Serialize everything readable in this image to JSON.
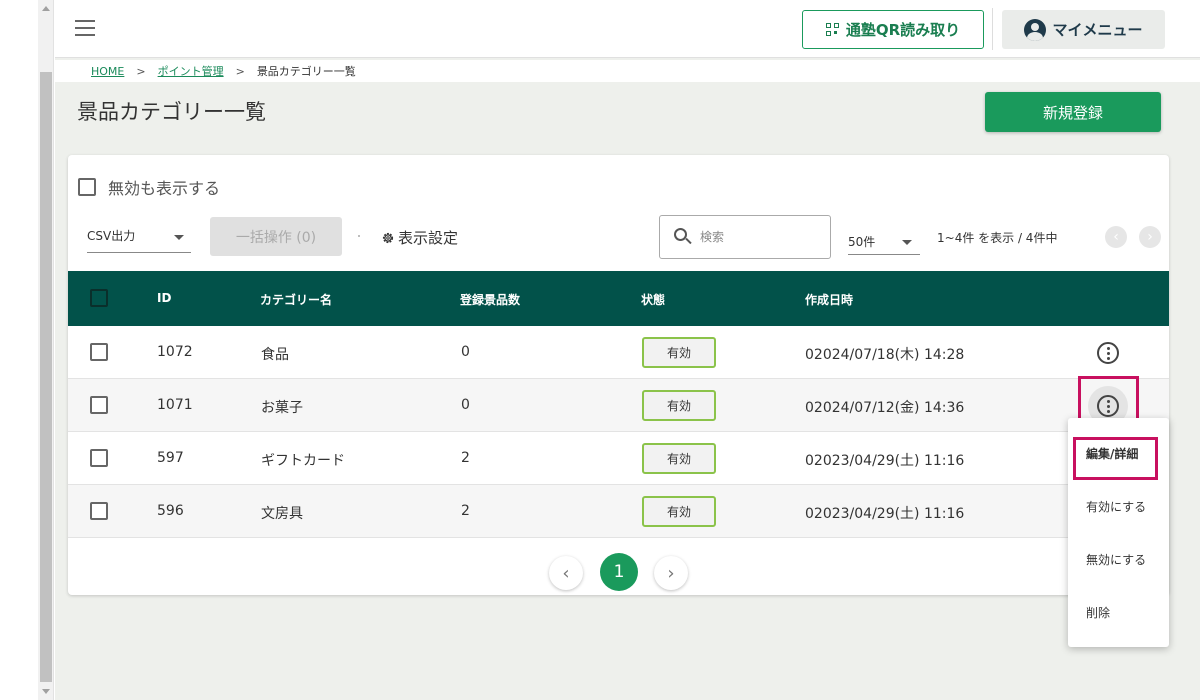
{
  "header": {
    "qr_button_label": "通塾QR読み取り",
    "mymenu_label": "マイメニュー"
  },
  "breadcrumb": {
    "home": "HOME",
    "sep": ">",
    "points": "ポイント管理",
    "current": "景品カテゴリー一覧"
  },
  "page": {
    "title": "景品カテゴリー一覧",
    "new_button": "新規登録"
  },
  "filters": {
    "show_invalid_label": "無効も表示する",
    "csv_label": "CSV出力",
    "bulk_label": "一括操作 (0)",
    "display_settings_label": "表示設定",
    "search_placeholder": "検索",
    "per_page": "50件",
    "range_text": "1~4件 を表示 / 4件中"
  },
  "table": {
    "headers": {
      "id": "ID",
      "name": "カテゴリー名",
      "count": "登録景品数",
      "status": "状態",
      "created": "作成日時"
    },
    "rows": [
      {
        "id": "1072",
        "name": "食品",
        "count": "0",
        "status": "有効",
        "created": "02024/07/18(木) 14:28"
      },
      {
        "id": "1071",
        "name": "お菓子",
        "count": "0",
        "status": "有効",
        "created": "02024/07/12(金) 14:36"
      },
      {
        "id": "597",
        "name": "ギフトカード",
        "count": "2",
        "status": "有効",
        "created": "02023/04/29(土) 11:16"
      },
      {
        "id": "596",
        "name": "文房具",
        "count": "2",
        "status": "有効",
        "created": "02023/04/29(土) 11:16"
      }
    ]
  },
  "pagination": {
    "current": "1",
    "prev": "‹",
    "next": "›"
  },
  "dropdown": {
    "edit": "編集/詳細",
    "enable": "有効にする",
    "disable": "無効にする",
    "delete": "削除"
  },
  "colors": {
    "accent": "#1a9a5c",
    "table_header": "#02524a",
    "highlight": "#c8105f"
  }
}
